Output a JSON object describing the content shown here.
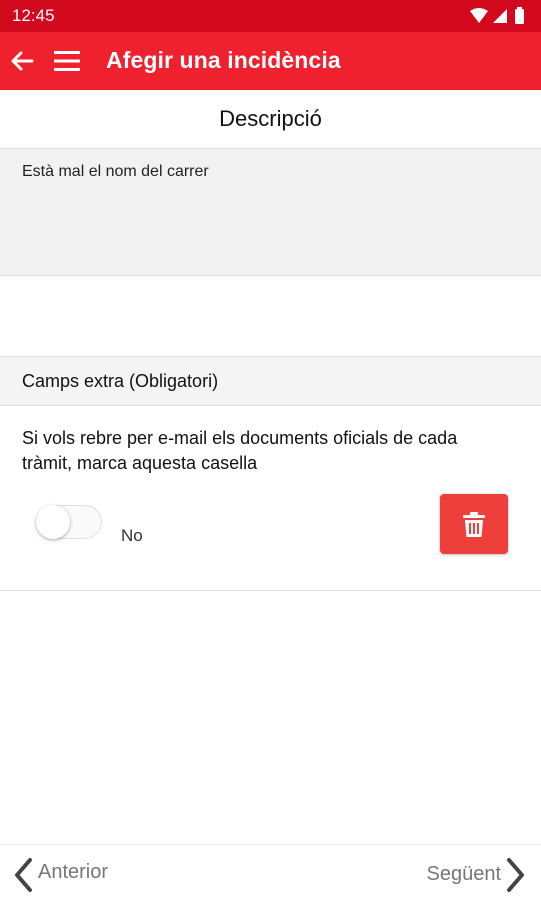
{
  "status_bar": {
    "time": "12:45",
    "icons": [
      "wifi-icon",
      "signal-icon",
      "battery-icon"
    ]
  },
  "app_bar": {
    "title": "Afegir una incidència",
    "background": "#f0212f",
    "icons": [
      "back-arrow-icon",
      "hamburger-menu-icon"
    ]
  },
  "section": {
    "title": "Descripció"
  },
  "description": {
    "value": "Està mal el nom del carrer"
  },
  "extra_fields": {
    "header": "Camps extra (Obligatori)",
    "question": "Si vols rebre per e-mail els documents oficials de cada tràmit, marca aquesta casella",
    "toggle_label": "No",
    "toggle_on": false,
    "delete_color": "#ef3f3a",
    "delete_icon": "trash-icon"
  },
  "navigation": {
    "prev_label": "Anterior",
    "next_label": "Següent",
    "icons": [
      "chevron-left-icon",
      "chevron-right-icon"
    ]
  }
}
